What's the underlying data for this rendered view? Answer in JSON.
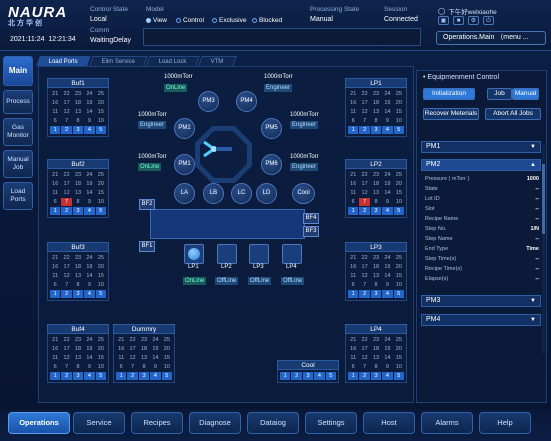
{
  "header": {
    "logo": "NAURA",
    "logo_cn": "北方华创",
    "date": "2021:11:24",
    "time": "12:21:34",
    "control_state_label": "Control State",
    "control_state": "Local",
    "model_label": "Model",
    "model_view": "View",
    "model_control": "Control",
    "model_exclusive": "Exclusive",
    "model_blocked": "Blocked",
    "comm_label": "Comm",
    "comm": "WaitingDelay",
    "processing_state_label": "Processing State",
    "processing_state": "Manual",
    "session_label": "Session",
    "session": "Connected",
    "user": "下午好welxiaohe",
    "operations_main": "Operations.Main （menu ..."
  },
  "left_nav": [
    "Main",
    "Process",
    "Gas Monitor",
    "Manual Job",
    "Load Ports"
  ],
  "tabs": [
    "Load Ports",
    "Elim Service",
    "Load Lock",
    "VTM"
  ],
  "chambers": {
    "pm1": "PM1",
    "pm2": "PM2",
    "pm3": "PM3",
    "pm4": "PM4",
    "pm5": "PM5",
    "pm6": "PM6",
    "la": "LA",
    "lb": "LB",
    "lc": "LC",
    "ld": "LD",
    "cool": "Cool",
    "pressure": "1000mTorr",
    "online": "OnLine",
    "engineer": "Engineer"
  },
  "buffers": {
    "bf1": "BF1",
    "bf2": "BF2",
    "bf3": "BF3",
    "bf4": "BF4"
  },
  "loadports": {
    "lp1": "LP1",
    "lp2": "LP2",
    "lp3": "LP3",
    "lp4": "LP4",
    "online": "OnLine",
    "offline": "OffLine"
  },
  "slots": {
    "r1": [
      "21",
      "22",
      "23",
      "24",
      "25"
    ],
    "r2": [
      "16",
      "17",
      "18",
      "19",
      "20"
    ],
    "r3": [
      "11",
      "12",
      "13",
      "14",
      "15"
    ],
    "r4": [
      "6",
      "7",
      "8",
      "9",
      "10"
    ],
    "r5": [
      "1",
      "2",
      "3",
      "4",
      "5"
    ]
  },
  "grids": {
    "buf1": "Buf1",
    "buf2": "Buf2",
    "buf3": "Buf3",
    "buf4": "Buf4",
    "dummy": "Dummry",
    "lp1": "LP1",
    "lp2": "LP2",
    "lp3": "LP3",
    "lp4": "LP4",
    "cool": "Cool"
  },
  "right": {
    "title": "Equipmenment Control",
    "init": "Initialization",
    "job": "Job",
    "manual": "Manual",
    "recover": "Recover Meterials",
    "abort": "Abort All Jobs",
    "pm1": "PM1",
    "pm2": "PM2",
    "pm3": "PM3",
    "pm4": "PM4",
    "params": [
      [
        "Pressure ( mTorr )",
        "1000"
      ],
      [
        "State",
        "--"
      ],
      [
        "Lot ID",
        "--"
      ],
      [
        "Slot",
        "--"
      ],
      [
        "Recipe Name",
        "--"
      ],
      [
        "Step No.",
        "1/N"
      ],
      [
        "Step Name",
        "--"
      ],
      [
        "End Type",
        "Time"
      ],
      [
        "Step Time(s)",
        "--"
      ],
      [
        "Recipe Time(s)",
        "--"
      ],
      [
        "Elapse(s)",
        "--"
      ]
    ]
  },
  "bottom_nav": [
    "Operations",
    "Service",
    "Recipes",
    "Diagnose",
    "Dataiog",
    "Settings",
    "Host",
    "Alarms",
    "Help"
  ],
  "colors": {
    "accent": "#2d78d8",
    "wafer": "#2266cc",
    "alarm": "#c63030",
    "online": "#6effd8"
  }
}
